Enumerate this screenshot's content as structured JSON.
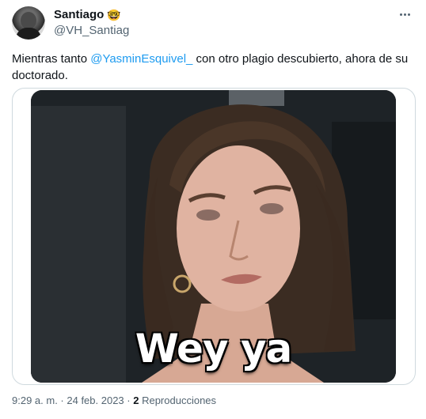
{
  "author": {
    "display_name": "Santiago",
    "emoji": "🤓",
    "handle": "@VH_Santiag"
  },
  "tweet": {
    "text_before": "Mientras tanto ",
    "mention": "@YasminEsquivel_",
    "text_after": "  con otro plagio descubierto, ahora de su doctorado."
  },
  "media": {
    "caption": "Wey ya"
  },
  "meta": {
    "time": "9:29 a. m.",
    "separator1": " · ",
    "date": "24 feb. 2023",
    "separator2": " · ",
    "views_count": "2",
    "views_label": " Reproducciones"
  },
  "icons": {
    "more": "more-horizontal-icon"
  },
  "colors": {
    "link": "#1d9bf0",
    "secondary_text": "#536471",
    "primary_text": "#0f1419",
    "border": "#cfd9de"
  }
}
